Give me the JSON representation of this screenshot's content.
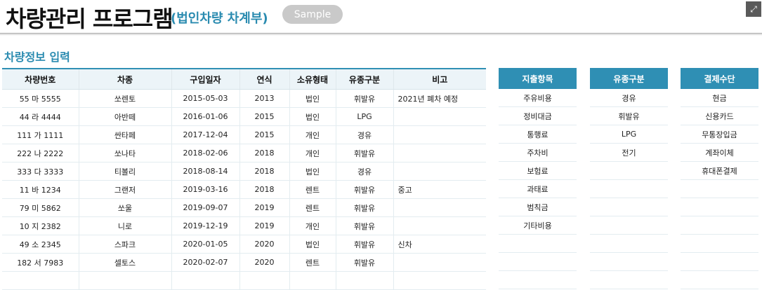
{
  "header": {
    "title": "차량관리 프로그램",
    "subtitle": "(법인차량 차계부)",
    "sample_label": "Sample"
  },
  "section": {
    "title": "차량정보 입력"
  },
  "vehicles": {
    "columns": [
      "차량번호",
      "차종",
      "구입일자",
      "연식",
      "소유형태",
      "유종구분",
      "비고"
    ],
    "rows": [
      [
        "55 마 5555",
        "쏘렌토",
        "2015-05-03",
        "2013",
        "법인",
        "휘발유",
        "2021년 폐차 예정"
      ],
      [
        "44 라 4444",
        "아반떼",
        "2016-01-06",
        "2015",
        "법인",
        "LPG",
        ""
      ],
      [
        "111 가 1111",
        "싼타페",
        "2017-12-04",
        "2015",
        "개인",
        "경유",
        ""
      ],
      [
        "222 나 2222",
        "쏘나타",
        "2018-02-06",
        "2018",
        "개인",
        "휘발유",
        ""
      ],
      [
        "333 다 3333",
        "티볼리",
        "2018-08-14",
        "2018",
        "법인",
        "경유",
        ""
      ],
      [
        "11 바 1234",
        "그랜저",
        "2019-03-16",
        "2018",
        "렌트",
        "휘발유",
        "중고"
      ],
      [
        "79 미 5862",
        "쏘울",
        "2019-09-07",
        "2019",
        "렌트",
        "휘발유",
        ""
      ],
      [
        "10 지 2382",
        "니로",
        "2019-12-19",
        "2019",
        "개인",
        "휘발유",
        ""
      ],
      [
        "49 소 2345",
        "스파크",
        "2020-01-05",
        "2020",
        "법인",
        "휘발유",
        "신차"
      ],
      [
        "182 서 7983",
        "셀토스",
        "2020-02-07",
        "2020",
        "렌트",
        "휘발유",
        ""
      ],
      [
        "",
        "",
        "",
        "",
        "",
        "",
        ""
      ]
    ]
  },
  "expense_items": {
    "header": "지출항목",
    "items": [
      "주유비용",
      "정비대금",
      "통행료",
      "주차비",
      "보험료",
      "과태료",
      "범칙금",
      "기타비용",
      "",
      "",
      ""
    ]
  },
  "fuel_types": {
    "header": "유종구분",
    "items": [
      "경유",
      "휘발유",
      "LPG",
      "전기",
      "",
      "",
      "",
      "",
      "",
      "",
      ""
    ]
  },
  "payment_methods": {
    "header": "결제수단",
    "items": [
      "현금",
      "신용카드",
      "무통장입금",
      "계좌이체",
      "휴대폰결제",
      "",
      "",
      "",
      "",
      "",
      ""
    ]
  },
  "icons": {
    "corner": "expand-icon"
  },
  "colors": {
    "accent": "#2f8fb4",
    "title_sub": "#2a8bb0",
    "header_bg": "#ecf4f8",
    "button_gray": "#c9c9c9"
  }
}
